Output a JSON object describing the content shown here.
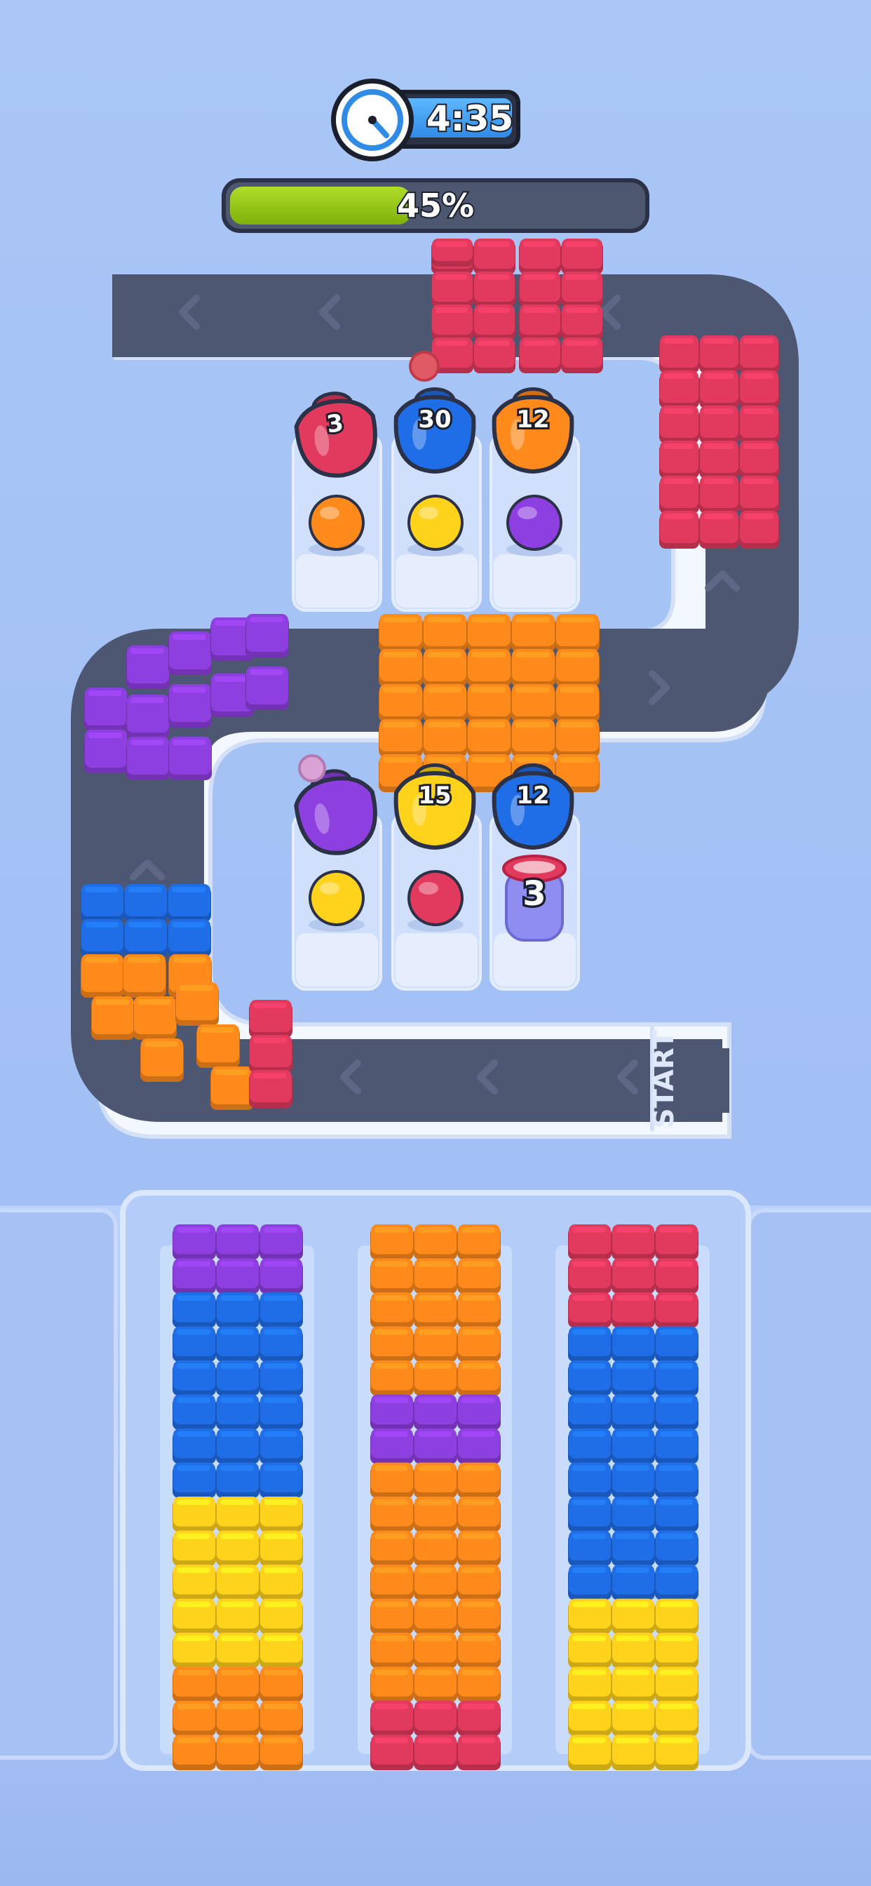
{
  "hud": {
    "timer": "4:35",
    "progress_text": "45%",
    "progress_fraction": 0.45
  },
  "track": {
    "start_label": "START"
  },
  "shooters": {
    "row1": [
      {
        "label": "3",
        "color": "red"
      },
      {
        "label": "30",
        "color": "blue"
      },
      {
        "label": "12",
        "color": "orange"
      }
    ],
    "row2": [
      {
        "label": "",
        "color": "purple"
      },
      {
        "label": "15",
        "color": "yellow"
      },
      {
        "label": "12",
        "color": "blue"
      }
    ],
    "queued_row1": [
      "orange",
      "yellow",
      "purple"
    ],
    "queued_row2": [
      "yellow",
      "red",
      "lavender"
    ],
    "launcher_count": "3"
  },
  "stacks": {
    "left": [
      "purple",
      "purple",
      "blue",
      "blue",
      "blue",
      "blue",
      "blue",
      "blue",
      "yellow",
      "yellow",
      "yellow",
      "yellow",
      "yellow",
      "orange",
      "orange",
      "orange"
    ],
    "middle": [
      "orange",
      "orange",
      "orange",
      "orange",
      "orange",
      "purple",
      "purple",
      "orange",
      "orange",
      "orange",
      "orange",
      "orange",
      "orange",
      "orange",
      "red",
      "red"
    ],
    "right": [
      "red",
      "red",
      "red",
      "blue",
      "blue",
      "blue",
      "blue",
      "blue",
      "blue",
      "blue",
      "blue",
      "yellow",
      "yellow",
      "yellow",
      "yellow",
      "yellow"
    ]
  },
  "colors": {
    "red": "#e23a5e",
    "blue": "#1f6ee8",
    "orange": "#ff8a1c",
    "yellow": "#ffd21c",
    "purple": "#8e3fe0",
    "lavender": "#8f8df0",
    "track": "#4e5772",
    "rail": "#f3f7ff"
  }
}
